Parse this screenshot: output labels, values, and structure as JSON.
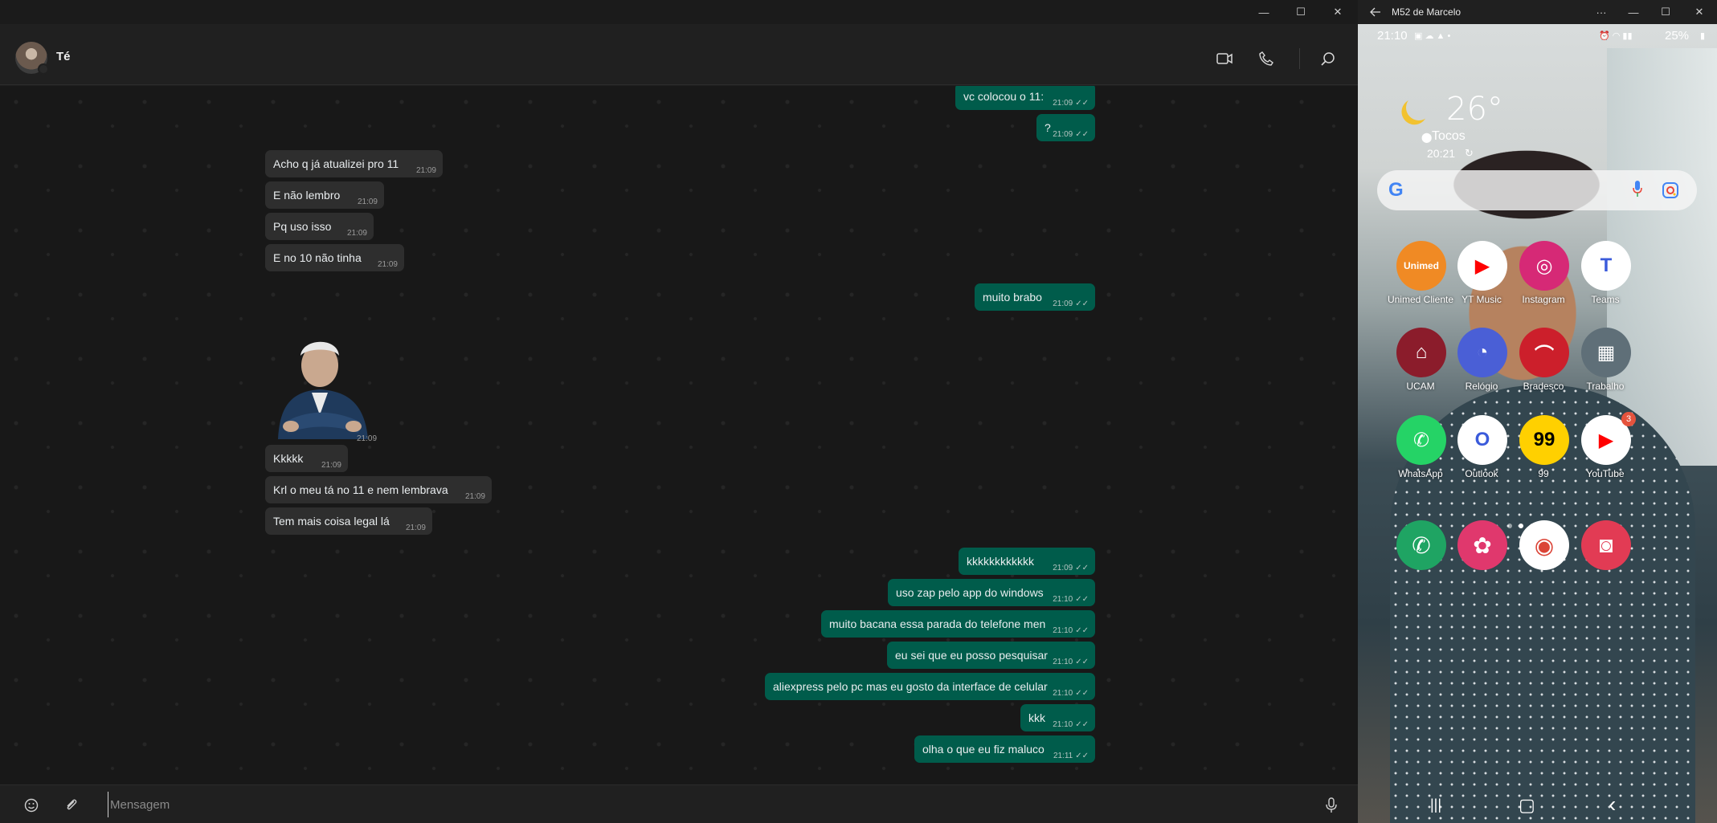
{
  "whatsapp": {
    "contact_name": "Té",
    "input_placeholder": "Mensagem",
    "window_controls": {
      "minimize": "—",
      "maximize": "☐",
      "close": "✕"
    },
    "messages": [
      {
        "dir": "out",
        "text": "vc colocou o 11:",
        "time": "21:09"
      },
      {
        "dir": "out",
        "text": "?",
        "time": "21:09"
      },
      {
        "dir": "in",
        "text": "Acho q já atualizei pro 11",
        "time": "21:09"
      },
      {
        "dir": "in",
        "text": "E não lembro",
        "time": "21:09"
      },
      {
        "dir": "in",
        "text": "Pq uso isso",
        "time": "21:09"
      },
      {
        "dir": "in",
        "text": "E no 10 não tinha",
        "time": "21:09"
      },
      {
        "dir": "out",
        "text": "muito brabo",
        "time": "21:09"
      },
      {
        "dir": "in",
        "text": "Kkkkk",
        "time": "21:09"
      },
      {
        "dir": "in",
        "text": "Krl o meu tá no 11 e nem lembrava",
        "time": "21:09"
      },
      {
        "dir": "in",
        "text": "Tem mais coisa legal lá",
        "time": "21:09"
      },
      {
        "dir": "out",
        "text": "kkkkkkkkkkkk",
        "time": "21:09"
      },
      {
        "dir": "out",
        "text": "uso zap pelo app do windows",
        "time": "21:10"
      },
      {
        "dir": "out",
        "text": "muito bacana essa parada do telefone men",
        "time": "21:10"
      },
      {
        "dir": "out",
        "text": "eu sei que eu posso pesquisar",
        "time": "21:10"
      },
      {
        "dir": "out",
        "text": "aliexpress pelo pc mas eu gosto da interface de celular",
        "time": "21:10"
      },
      {
        "dir": "out",
        "text": "kkk",
        "time": "21:10"
      },
      {
        "dir": "out",
        "text": "olha o que eu fiz maluco",
        "time": "21:11"
      }
    ],
    "sticker_time": "21:09",
    "tick": "✓✓"
  },
  "phone": {
    "window_title": "M52 de Marcelo",
    "title_more": "···",
    "status_time": "21:10",
    "battery": "25%",
    "weather": {
      "temp": "26°",
      "location": "Tocos",
      "time": "20:21"
    },
    "apps": [
      {
        "name": "Unimed Cliente",
        "icon": "unimed-icon",
        "color": "#f08a24",
        "glyph": "Unimed"
      },
      {
        "name": "YT Music",
        "icon": "yt-music-icon",
        "color": "#ffffff",
        "glyph": "▶"
      },
      {
        "name": "Instagram",
        "icon": "instagram-icon",
        "color": "#d62976",
        "glyph": "◎"
      },
      {
        "name": "Teams",
        "icon": "teams-icon",
        "color": "#ffffff",
        "glyph": "T"
      },
      {
        "name": "UCAM",
        "icon": "ucam-icon",
        "color": "#8b1c2b",
        "glyph": "⌂"
      },
      {
        "name": "Relógio",
        "icon": "clock-icon",
        "color": "#4a5fd6",
        "glyph": "◔"
      },
      {
        "name": "Bradesco",
        "icon": "bradesco-icon",
        "color": "#cc1f2b",
        "glyph": "⌒"
      },
      {
        "name": "Trabalho",
        "icon": "folder-icon",
        "color": "#5f6f78",
        "glyph": "▦"
      },
      {
        "name": "WhatsApp",
        "icon": "whatsapp-icon",
        "color": "#25d366",
        "glyph": "✆"
      },
      {
        "name": "Outlook",
        "icon": "outlook-icon",
        "color": "#ffffff",
        "glyph": "O"
      },
      {
        "name": "99",
        "icon": "app-99-icon",
        "color": "#ffd000",
        "glyph": "99"
      },
      {
        "name": "YouTube",
        "icon": "youtube-icon",
        "color": "#ffffff",
        "glyph": "▶",
        "badge": "3"
      }
    ],
    "dock": [
      {
        "icon": "phone-icon",
        "color": "#1fa463",
        "glyph": "✆"
      },
      {
        "icon": "blossom-icon",
        "color": "#e0386d",
        "glyph": "✿"
      },
      {
        "icon": "chrome-icon",
        "color": "#ffffff",
        "glyph": "◉"
      },
      {
        "icon": "camera-icon",
        "color": "#e23b54",
        "glyph": "◙"
      }
    ],
    "nav": {
      "recents": "|||",
      "home": "▢",
      "back": "‹"
    }
  }
}
